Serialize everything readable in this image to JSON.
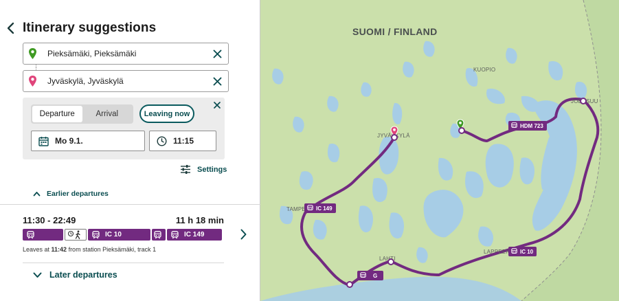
{
  "header": {
    "title": "Itinerary suggestions"
  },
  "from": {
    "value": "Pieksämäki, Pieksämäki"
  },
  "to": {
    "value": "Jyväskylä, Jyväskylä"
  },
  "time_select": {
    "tabs": [
      "Departure",
      "Arrival"
    ],
    "active_tab": "Departure",
    "leaving_now_label": "Leaving now",
    "date": "Mo 9.1.",
    "time": "11:15"
  },
  "settings_label": "Settings",
  "earlier_label": "Earlier departures",
  "later_label": "Later departures",
  "trip": {
    "times": "11:30 - 22:49",
    "duration": "11 h 18 min",
    "legs": [
      {
        "type": "train",
        "label": ""
      },
      {
        "type": "walk",
        "label": ""
      },
      {
        "type": "train",
        "label": "IC 10"
      },
      {
        "type": "train",
        "label": ""
      },
      {
        "type": "train",
        "label": "IC 149"
      }
    ],
    "info_prefix": "Leaves at ",
    "info_time": "11:42",
    "info_suffix": " from station Pieksämäki, track 1"
  },
  "map": {
    "country_label": "SUOMI / FINLAND",
    "cities": [
      "KUOPIO",
      "JYVÄSKYLÄ",
      "TAMPERE",
      "LAHTI",
      "LAPPEENRANTA",
      "JOENSUU"
    ],
    "tags": [
      "HDM 723",
      "IC 149",
      "IC 10",
      "G"
    ],
    "colors": {
      "route": "#722a80",
      "origin_pin": "#3f9a23",
      "destination_pin": "#e0457b",
      "water": "#a7cde6",
      "land": "#cbe0ab"
    }
  },
  "icons": [
    "back-arrow-icon",
    "origin-pin-icon",
    "destination-pin-icon",
    "clear-icon",
    "close-icon",
    "calendar-icon",
    "clock-icon",
    "settings-sliders-icon",
    "chevron-up-icon",
    "chevron-down-icon",
    "train-icon",
    "walk-icon",
    "chevron-right-icon"
  ]
}
